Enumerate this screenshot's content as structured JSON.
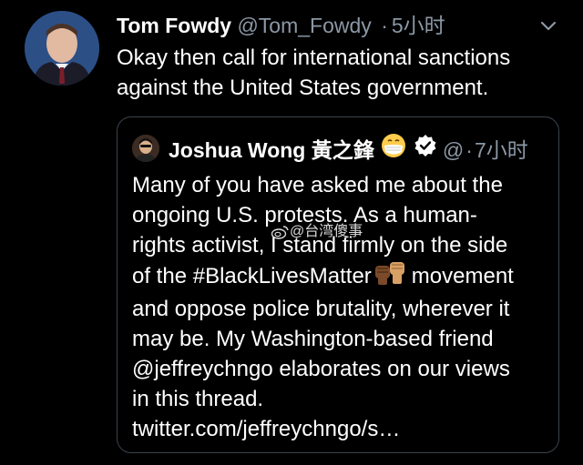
{
  "tweet": {
    "author_name": "Tom Fowdy",
    "author_handle": "@Tom_Fowdy",
    "separator": "·",
    "time": "5小时",
    "text": "Okay then call for international sanctions against the United States government."
  },
  "quoted_tweet": {
    "author_name": "Joshua Wong 黃之鋒",
    "author_handle": "@",
    "separator": "·",
    "time": "7小时",
    "lines": [
      "Many of you have asked me about the",
      "ongoing U.S. protests. As a human-",
      "rights activist, I stand firmly on the side",
      "of the #BlackLivesMatter",
      "movement",
      "and oppose police brutality, wherever it",
      "may be. My Washington-based friend",
      "@jeffreychngo elaborates on our views",
      "in this thread.",
      "twitter.com/jeffreychngo/s…"
    ]
  },
  "watermark": {
    "text": "@台湾傻事"
  },
  "icons": {
    "caret": "chevron-down-icon",
    "emoji": "mask-face-emoji-icon",
    "verified": "verified-badge-icon",
    "fists": "raised-fists-emoji-icon",
    "weibo": "weibo-logo-icon"
  },
  "colors": {
    "background": "#000000",
    "text": "#ffffff",
    "secondary": "#8b98a5",
    "border": "#3a444c"
  }
}
